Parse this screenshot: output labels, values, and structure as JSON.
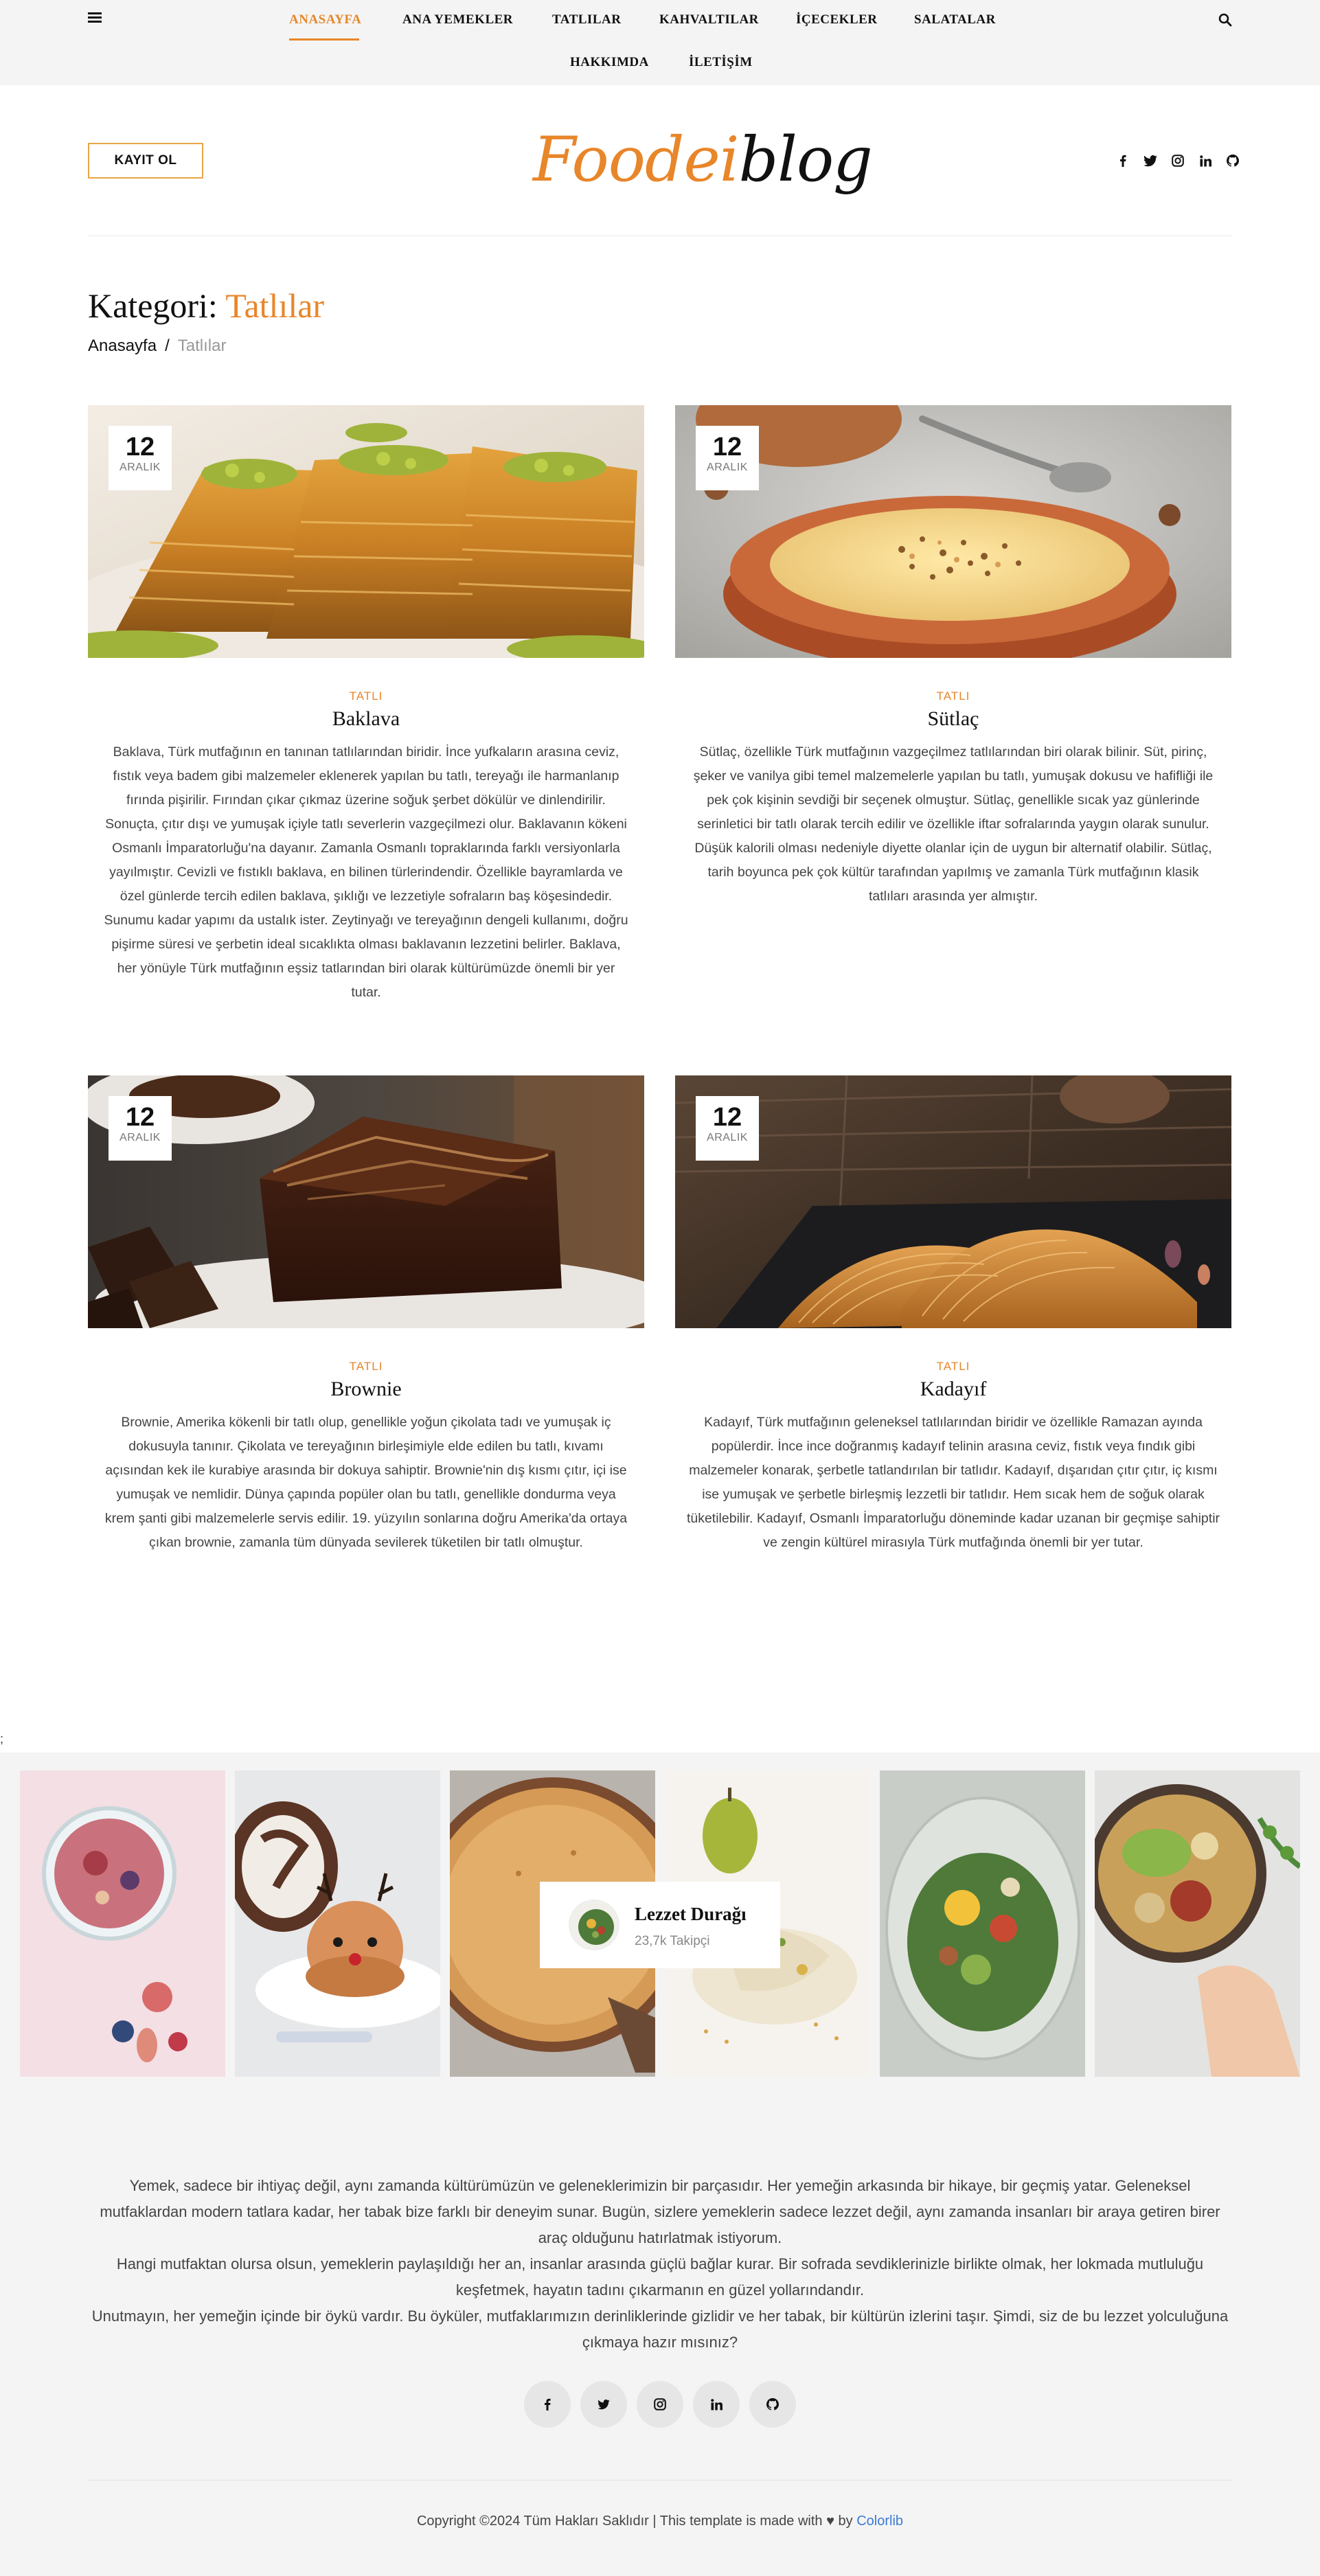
{
  "nav": {
    "items": [
      {
        "label": "ANASAYFA",
        "active": true
      },
      {
        "label": "ANA YEMEKLER"
      },
      {
        "label": "TATLILAR"
      },
      {
        "label": "KAHVALTILAR"
      },
      {
        "label": "İÇECEKLER"
      },
      {
        "label": "SALATALAR"
      },
      {
        "label": "HAKKIMDA"
      },
      {
        "label": "İLETİŞİM"
      }
    ],
    "menu_icon": "hamburger-icon",
    "search_icon": "search-icon"
  },
  "header": {
    "signup_label": "KAYIT OL",
    "logo_part1": "Foodei",
    "logo_part2": "blog",
    "socials": [
      "facebook-icon",
      "twitter-icon",
      "instagram-icon",
      "linkedin-icon",
      "github-icon"
    ]
  },
  "page": {
    "title_prefix": "Kategori: ",
    "title_accent": "Tatlılar",
    "breadcrumb": {
      "home": "Anasayfa",
      "sep": "/",
      "current": "Tatlılar"
    }
  },
  "posts": [
    {
      "day": "12",
      "month": "ARALIK",
      "category": "TATLI",
      "title": "Baklava",
      "lines": [
        "Baklava, Türk mutfağının en tanınan tatlılarından biridir. İnce yufkaların arasına ceviz,",
        "fıstık veya badem gibi malzemeler eklenerek yapılan bu tatlı, tereyağı ile harmanlanıp",
        "fırında pişirilir. Fırından çıkar çıkmaz üzerine soğuk şerbet dökülür ve dinlendirilir.",
        "Sonuçta, çıtır dışı ve yumuşak içiyle tatlı severlerin vazgeçilmezi olur. Baklavanın kökeni",
        "Osmanlı İmparatorluğu'na dayanır. Zamanla Osmanlı topraklarında farklı versiyonlarla",
        "yayılmıştır. Cevizli ve fıstıklı baklava, en bilinen türlerindendir. Özellikle bayramlarda ve",
        "özel günlerde tercih edilen baklava, şıklığı ve lezzetiyle sofraların baş köşesindedir.",
        "Sunumu kadar yapımı da ustalık ister. Zeytinyağı ve tereyağının dengeli kullanımı, doğru",
        "pişirme süresi ve şerbetin ideal sıcaklıkta olması baklavanın lezzetini belirler. Baklava,",
        "her yönüyle Türk mutfağının eşsiz tatlarından biri olarak kültürümüzde önemli bir yer",
        "tutar."
      ]
    },
    {
      "day": "12",
      "month": "ARALIK",
      "category": "TATLI",
      "title": "Sütlaç",
      "lines": [
        "Sütlaç, özellikle Türk mutfağının vazgeçilmez tatlılarından biri olarak bilinir. Süt, pirinç,",
        "şeker ve vanilya gibi temel malzemelerle yapılan bu tatlı, yumuşak dokusu ve hafifliği ile",
        "pek çok kişinin sevdiği bir seçenek olmuştur. Sütlaç, genellikle sıcak yaz günlerinde",
        "serinletici bir tatlı olarak tercih edilir ve özellikle iftar sofralarında yaygın olarak sunulur.",
        "Düşük kalorili olması nedeniyle diyette olanlar için de uygun bir alternatif olabilir. Sütlaç,",
        "tarih boyunca pek çok kültür tarafından yapılmış ve zamanla Türk mutfağının klasik",
        "tatlıları arasında yer almıştır."
      ]
    },
    {
      "day": "12",
      "month": "ARALIK",
      "category": "TATLI",
      "title": "Brownie",
      "lines": [
        "Brownie, Amerika kökenli bir tatlı olup, genellikle yoğun çikolata tadı ve yumuşak iç",
        "dokusuyla tanınır. Çikolata ve tereyağının birleşimiyle elde edilen bu tatlı, kıvamı",
        "açısından kek ile kurabiye arasında bir dokuya sahiptir. Brownie'nin dış kısmı çıtır, içi ise",
        "yumuşak ve nemlidir. Dünya çapında popüler olan bu tatlı, genellikle dondurma veya",
        "krem şanti gibi malzemelerle servis edilir. 19. yüzyılın sonlarına doğru Amerika'da ortaya",
        "çıkan brownie, zamanla tüm dünyada sevilerek tüketilen bir tatlı olmuştur."
      ]
    },
    {
      "day": "12",
      "month": "ARALIK",
      "category": "TATLI",
      "title": "Kadayıf",
      "lines": [
        "Kadayıf, Türk mutfağının geleneksel tatlılarından biridir ve özellikle Ramazan ayında",
        "popülerdir. İnce ince doğranmış kadayıf telinin arasına ceviz, fıstık veya fındık gibi",
        "malzemeler konarak, şerbetle tatlandırılan bir tatlıdır. Kadayıf, dışarıdan çıtır çıtır, iç kısmı",
        "ise yumuşak ve şerbetle birleşmiş lezzetli bir tatlıdır. Hem sıcak hem de soğuk olarak",
        "tüketilebilir. Kadayıf, Osmanlı İmparatorluğu döneminde kadar uzanan bir geçmişe sahiptir",
        "ve zengin kültürel mirasıyla Türk mutfağında önemli bir yer tutar."
      ]
    }
  ],
  "stray_text": ";",
  "insta": {
    "name": "Lezzet Durağı",
    "followers": "23,7k Takipçi"
  },
  "footer": {
    "lines": [
      "Yemek, sadece bir ihtiyaç değil, aynı zamanda kültürümüzün ve geleneklerimizin bir parçasıdır. Her yemeğin arkasında bir hikaye, bir geçmiş yatar. Geleneksel",
      "mutfaklardan modern tatlara kadar, her tabak bize farklı bir deneyim sunar. Bugün, sizlere yemeklerin sadece lezzet değil, aynı zamanda insanları bir araya getiren birer",
      "araç olduğunu hatırlatmak istiyorum.",
      "Hangi mutfaktan olursa olsun, yemeklerin paylaşıldığı her an, insanlar arasında güçlü bağlar kurar. Bir sofrada sevdiklerinizle birlikte olmak, her lokmada mutluluğu",
      "keşfetmek, hayatın tadını çıkarmanın en güzel yollarındandır.",
      "Unutmayın, her yemeğin içinde bir öykü vardır. Bu öyküler, mutfaklarımızın derinliklerinde gizlidir ve her tabak, bir kültürün izlerini taşır. Şimdi, siz de bu lezzet yolculuğuna",
      "çıkmaya hazır mısınız?"
    ],
    "copyright_prefix": "Copyright ©2024 Tüm Hakları Saklıdır | This template is made with ",
    "copyright_mid": " by ",
    "copyright_link": "Colorlib"
  },
  "colors": {
    "accent": "#e8862a",
    "link": "#3a7bd5",
    "background": "#f4f4f4"
  }
}
